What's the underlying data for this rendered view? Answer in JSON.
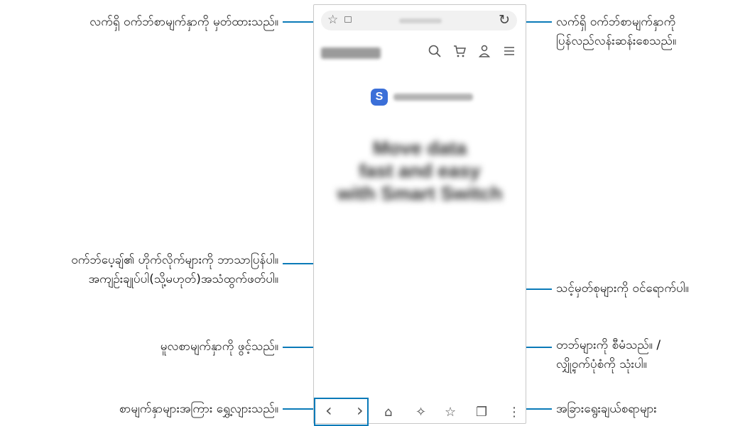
{
  "callouts": {
    "bookmark": "လက်ရှိ ဝက်ဘ်စာမျက်နှာကို မှတ်ထားသည်။",
    "reload_line1": "လက်ရှိ ဝက်ဘ်စာမျက်နှာကို",
    "reload_line2": "ပြန်လည်လန်းဆန်းစေသည်။",
    "ai_line1": "ဝက်ဘ်ပေ့ချ်၏ ဟိုက်လိုက်များကို ဘာသာပြန်ပါ။",
    "ai_line2": "အကျဉ်းချုပ်ပါ(သို့မဟုတ်)အသံထွက်ဖတ်ပါ။",
    "bookmarks": "သင့်မှတ်စုများကို ဝင်ရောက်ပါ။",
    "home": "မူလစာမျက်နှာကို ဖွင့်သည်။",
    "tabs_line1": "တဘ်များကို စီမံသည်။ /",
    "tabs_line2": "လျှို့ဝှက်ပုံစံကို သုံးပါ။",
    "navigate": "စာမျက်နှာများအကြား ရွှေ့လျားသည်။",
    "options": "အခြားရွေးချယ်စရာများ"
  },
  "browser": {
    "bookmark_icon": "☆",
    "reload_icon": "↻",
    "site_icons": [
      "search-icon",
      "cart-icon",
      "account-icon",
      "menu-icon"
    ],
    "brand_letter": "S",
    "hero": [
      "Move data",
      "fast and easy",
      "with Smart Switch"
    ],
    "toolbar": {
      "back": "‹",
      "forward": "›",
      "home": "⌂",
      "ai": "✧",
      "bookmarks": "☆",
      "tabs": "❐",
      "more": "⋮"
    }
  },
  "colors": {
    "accent": "#0a7ab8",
    "brand_badge": "#3b6fd8"
  }
}
